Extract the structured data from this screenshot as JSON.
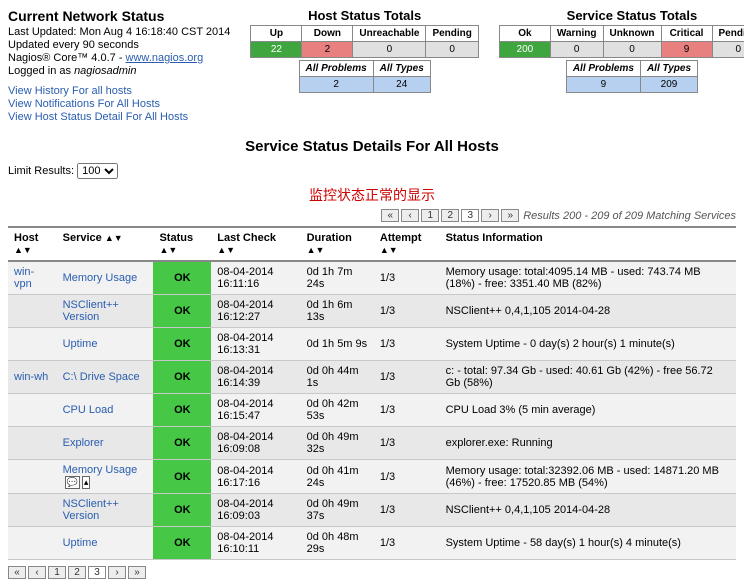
{
  "header": {
    "title": "Current Network Status",
    "last_updated": "Last Updated: Mon Aug 4 16:18:40 CST 2014",
    "updated_every": "Updated every 90 seconds",
    "nagios_prefix": "Nagios® Core™ 4.0.7 - ",
    "nagios_link": "www.nagios.org",
    "logged_in_prefix": "Logged in as ",
    "logged_in_user": "nagiosadmin",
    "links": {
      "history": "View History For all hosts",
      "notifications": "View Notifications For All Hosts",
      "detail": "View Host Status Detail For All Hosts"
    }
  },
  "host_totals": {
    "title": "Host Status Totals",
    "cols": {
      "up": "Up",
      "down": "Down",
      "unreach": "Unreachable",
      "pending": "Pending"
    },
    "vals": {
      "up": "22",
      "down": "2",
      "unreach": "0",
      "pending": "0"
    },
    "problems_label": "All Problems",
    "types_label": "All Types",
    "problems": "2",
    "types": "24"
  },
  "service_totals": {
    "title": "Service Status Totals",
    "cols": {
      "ok": "Ok",
      "warning": "Warning",
      "unknown": "Unknown",
      "critical": "Critical",
      "pending": "Pending"
    },
    "vals": {
      "ok": "200",
      "warning": "0",
      "unknown": "0",
      "critical": "9",
      "pending": "0"
    },
    "problems_label": "All Problems",
    "types_label": "All Types",
    "problems": "9",
    "types": "209"
  },
  "section_title": "Service Status Details For All Hosts",
  "limit": {
    "label": "Limit Results: ",
    "value": "100"
  },
  "annotation": "监控状态正常的显示",
  "results_summary": "Results 200 - 209 of 209 Matching Services",
  "columns": {
    "host": "Host",
    "service": "Service",
    "status": "Status",
    "last_check": "Last Check",
    "duration": "Duration",
    "attempt": "Attempt",
    "info": "Status Information"
  },
  "pager": {
    "p1": "1",
    "p2": "2",
    "p3": "3"
  },
  "rows": [
    {
      "host": "win-vpn",
      "service": "Memory Usage",
      "status": "OK",
      "last_check": "08-04-2014 16:11:16",
      "duration": "0d 1h 7m 24s",
      "attempt": "1/3",
      "info": "Memory usage: total:4095.14 MB - used: 743.74 MB (18%) - free: 3351.40 MB (82%)"
    },
    {
      "host": "",
      "service": "NSClient++ Version",
      "status": "OK",
      "last_check": "08-04-2014 16:12:27",
      "duration": "0d 1h 6m 13s",
      "attempt": "1/3",
      "info": "NSClient++ 0,4,1,105 2014-04-28"
    },
    {
      "host": "",
      "service": "Uptime",
      "status": "OK",
      "last_check": "08-04-2014 16:13:31",
      "duration": "0d 1h 5m 9s",
      "attempt": "1/3",
      "info": "System Uptime - 0 day(s) 2 hour(s) 1 minute(s)"
    },
    {
      "host": "win-wh",
      "service": "C:\\ Drive Space",
      "status": "OK",
      "last_check": "08-04-2014 16:14:39",
      "duration": "0d 0h 44m 1s",
      "attempt": "1/3",
      "info": "c: - total: 97.34 Gb - used: 40.61 Gb (42%) - free 56.72 Gb (58%)"
    },
    {
      "host": "",
      "service": "CPU Load",
      "status": "OK",
      "last_check": "08-04-2014 16:15:47",
      "duration": "0d 0h 42m 53s",
      "attempt": "1/3",
      "info": "CPU Load 3% (5 min average)"
    },
    {
      "host": "",
      "service": "Explorer",
      "status": "OK",
      "last_check": "08-04-2014 16:09:08",
      "duration": "0d 0h 49m 32s",
      "attempt": "1/3",
      "info": "explorer.exe: Running"
    },
    {
      "host": "",
      "service": "Memory Usage",
      "status": "OK",
      "last_check": "08-04-2014 16:17:16",
      "duration": "0d 0h 41m 24s",
      "attempt": "1/3",
      "info": "Memory usage: total:32392.06 MB - used: 14871.20 MB (46%) - free: 17520.85 MB (54%)",
      "icons": true
    },
    {
      "host": "",
      "service": "NSClient++ Version",
      "status": "OK",
      "last_check": "08-04-2014 16:09:03",
      "duration": "0d 0h 49m 37s",
      "attempt": "1/3",
      "info": "NSClient++ 0,4,1,105 2014-04-28"
    },
    {
      "host": "",
      "service": "Uptime",
      "status": "OK",
      "last_check": "08-04-2014 16:10:11",
      "duration": "0d 0h 48m 29s",
      "attempt": "1/3",
      "info": "System Uptime - 58 day(s) 1 hour(s) 4 minute(s)"
    }
  ]
}
